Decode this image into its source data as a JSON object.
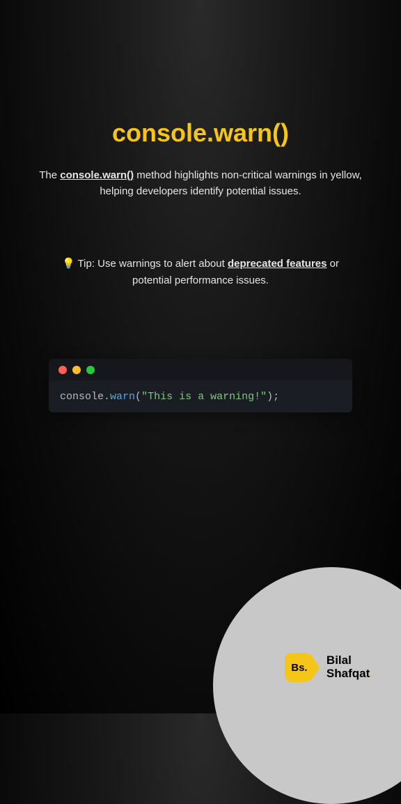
{
  "title": "console.warn()",
  "description": {
    "pre": "The ",
    "underlined": "console.warn()",
    "post": " method highlights non-critical warnings in yellow, helping developers identify potential issues."
  },
  "tip": {
    "icon": "💡",
    "pre": " Tip: Use warnings to alert about ",
    "underlined": "deprecated features",
    "post": " or potential performance issues."
  },
  "code": {
    "obj": "console",
    "dot": ".",
    "method": "warn",
    "paren_open": "(",
    "string": "\"This is a warning!\"",
    "paren_close": ")",
    "semi": ";"
  },
  "author": {
    "badge": "Bs.",
    "first": "Bilal",
    "last": "Shafqat"
  }
}
